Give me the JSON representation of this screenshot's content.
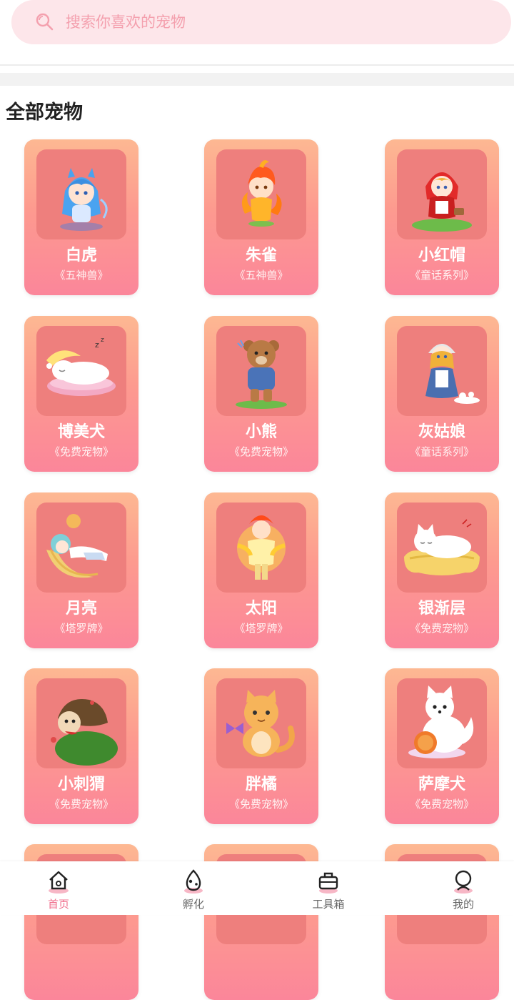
{
  "search": {
    "placeholder": "搜索你喜欢的宠物"
  },
  "section": {
    "title": "全部宠物"
  },
  "pets": [
    {
      "name": "白虎",
      "series": "《五神兽》",
      "icon": "blue-haired-girl-icon"
    },
    {
      "name": "朱雀",
      "series": "《五神兽》",
      "icon": "fire-girl-icon"
    },
    {
      "name": "小红帽",
      "series": "《童话系列》",
      "icon": "red-hood-girl-icon"
    },
    {
      "name": "博美犬",
      "series": "《免费宠物》",
      "icon": "sleeping-dog-icon"
    },
    {
      "name": "小熊",
      "series": "《免费宠物》",
      "icon": "teddy-bear-icon"
    },
    {
      "name": "灰姑娘",
      "series": "《童话系列》",
      "icon": "cinderella-icon"
    },
    {
      "name": "月亮",
      "series": "《塔罗牌》",
      "icon": "moon-girl-icon"
    },
    {
      "name": "太阳",
      "series": "《塔罗牌》",
      "icon": "sun-boy-icon"
    },
    {
      "name": "银渐层",
      "series": "《免费宠物》",
      "icon": "white-cat-icon"
    },
    {
      "name": "小刺猬",
      "series": "《免费宠物》",
      "icon": "hedgehog-icon"
    },
    {
      "name": "胖橘",
      "series": "《免费宠物》",
      "icon": "orange-cat-icon"
    },
    {
      "name": "萨摩犬",
      "series": "《免费宠物》",
      "icon": "samoyed-icon"
    }
  ],
  "nav": [
    {
      "label": "首页",
      "icon": "home-icon",
      "active": true
    },
    {
      "label": "孵化",
      "icon": "egg-icon",
      "active": false
    },
    {
      "label": "工具箱",
      "icon": "toolbox-icon",
      "active": false
    },
    {
      "label": "我的",
      "icon": "profile-icon",
      "active": false
    }
  ],
  "colors": {
    "accent": "#f06f8d",
    "card_top": "#fdb892",
    "card_bottom": "#fb869a",
    "image_bg": "#ee7f7d",
    "search_bg": "#fde6ea"
  }
}
